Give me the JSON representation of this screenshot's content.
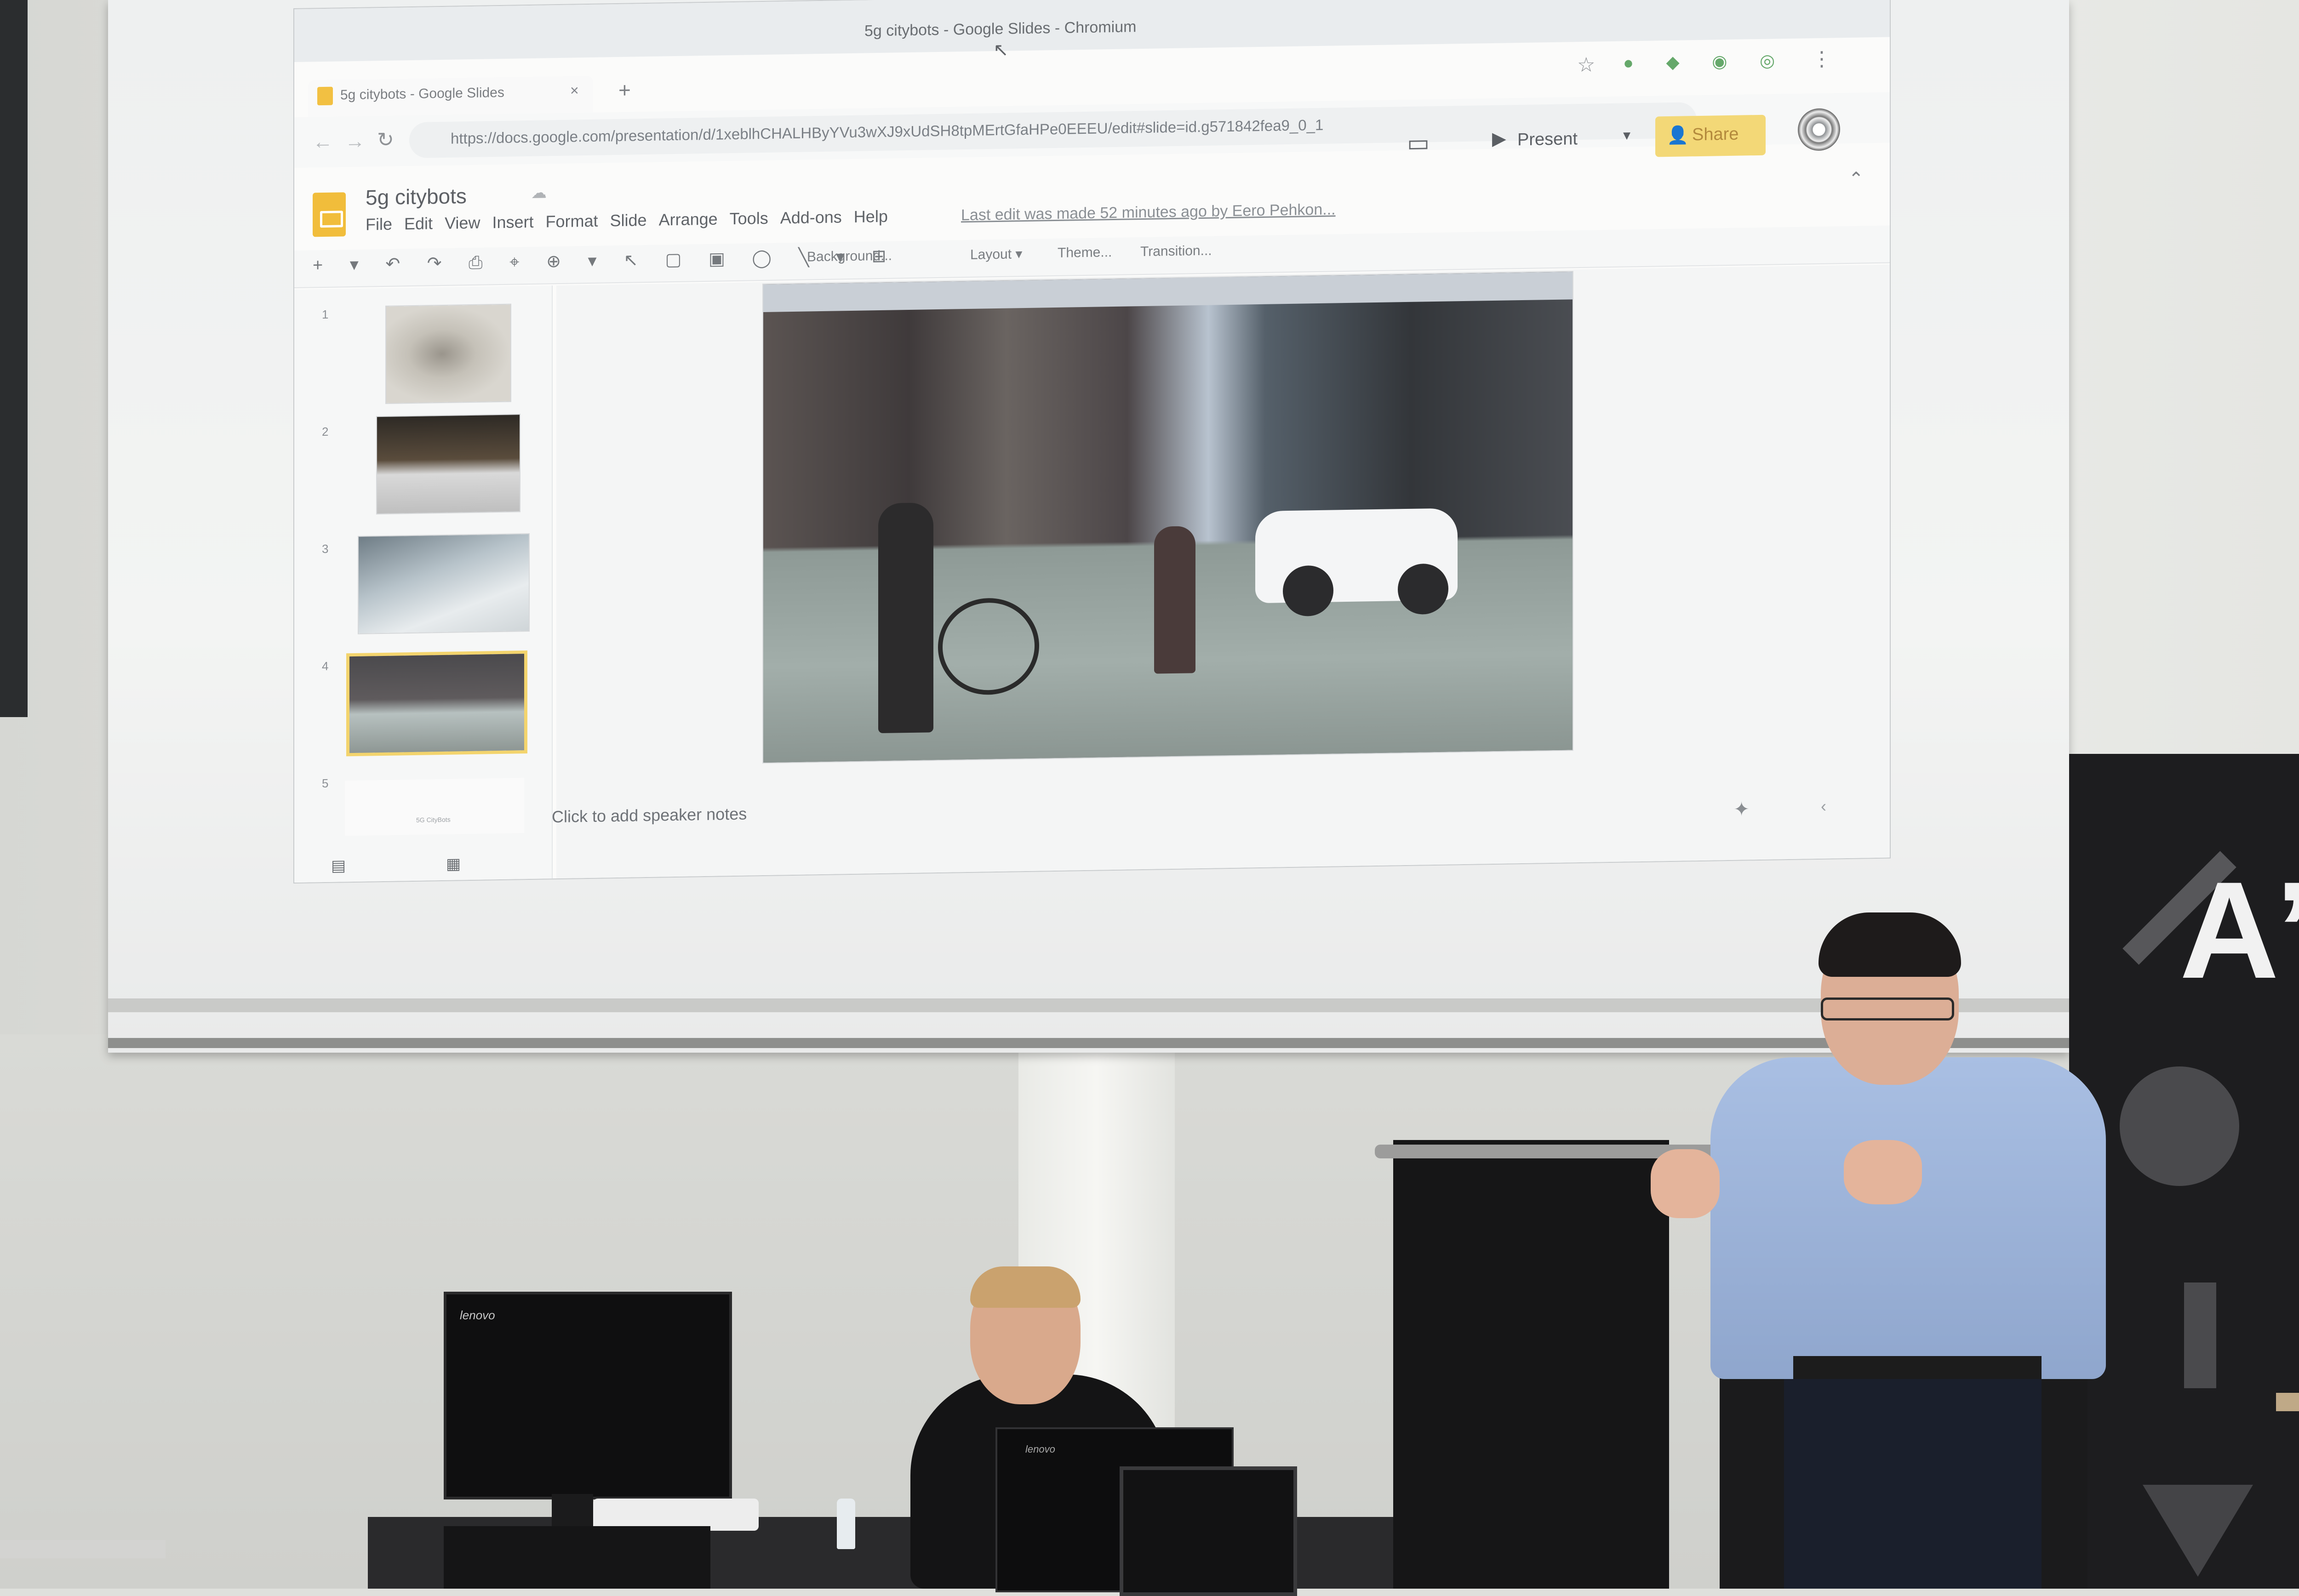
{
  "browser": {
    "window_title": "5g citybots - Google Slides - Chromium",
    "tab_title": "5g citybots - Google Slides",
    "tab_close": "×",
    "new_tab": "+",
    "url": "https://docs.google.com/presentation/d/1xeblhCHALHByYVu3wXJ9xUdSH8tpMErtGfaHPe0EEEU/edit#slide=id.g571842fea9_0_1",
    "star": "☆",
    "extensions": "● ◆ ◉ ◎",
    "more_menu": "⋮"
  },
  "slides_app": {
    "doc_title": "5g citybots",
    "menus": [
      "File",
      "Edit",
      "View",
      "Insert",
      "Format",
      "Slide",
      "Arrange",
      "Tools",
      "Add-ons",
      "Help"
    ],
    "last_edit": "Last edit was made 52 minutes ago by Eero Pehkon...",
    "present_label": "Present",
    "share_label": "Share",
    "toolbar": {
      "background": "Background...",
      "layout": "Layout ▾",
      "theme": "Theme...",
      "transition": "Transition..."
    },
    "slide_numbers": [
      "1",
      "2",
      "3",
      "4",
      "5"
    ],
    "selected_slide": 4,
    "thumb5_caption": "5G CityBots",
    "speaker_notes_placeholder": "Click to add speaker notes"
  },
  "monitor_brand": "lenovo",
  "laptop_brand": "lenovo",
  "banner_mark": "A”",
  "colors": {
    "share_button": "#f3d877",
    "doc_icon": "#f1bd3b",
    "selected_thumb_border": "#f3d46d",
    "banner": "#1d1d1f"
  },
  "icons": {
    "back": "←",
    "forward": "→",
    "reload": "↻",
    "comment": "▭",
    "present": "▶",
    "caret": "▾",
    "share": "👤",
    "collapse": "⌃",
    "cloud": "☁",
    "tools": "+ ▾ ↶ ↷ ⎙ ⌖ ⊕ ▾ ↖ ▢ ▣ ◯ ╲ ▾ ⊞",
    "list_view": "▤",
    "grid_view": "▦",
    "explore": "✦",
    "side_caret": "‹",
    "cursor": "↖"
  }
}
